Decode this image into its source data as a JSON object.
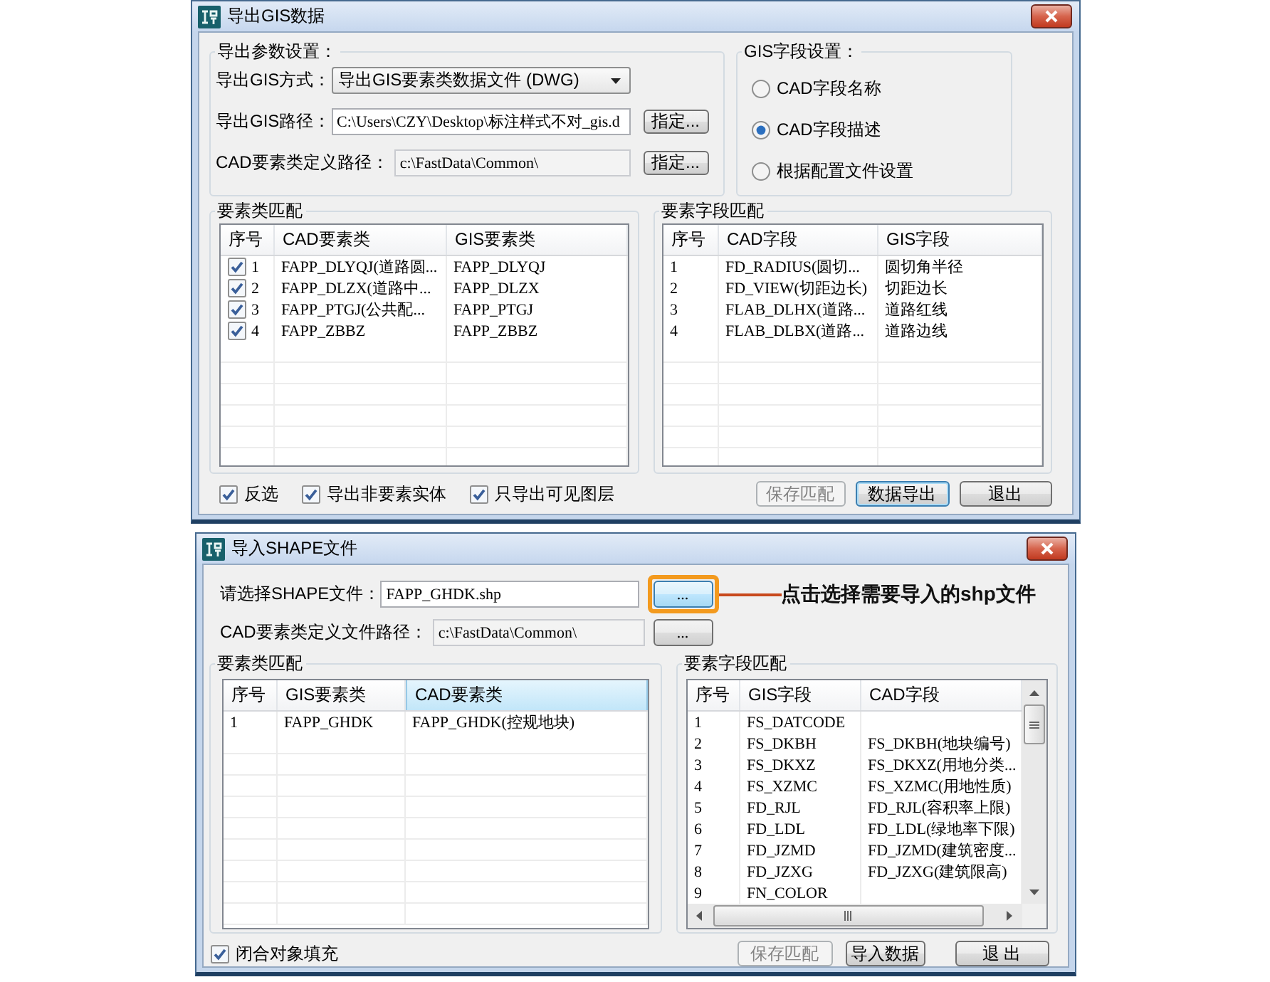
{
  "export_dialog": {
    "title": "导出GIS数据",
    "params": {
      "title": "导出参数设置：",
      "fields": [
        {
          "kind": "dropdown",
          "label": "导出GIS方式：",
          "value": "导出GIS要素类数据文件 (DWG)"
        },
        {
          "kind": "path",
          "label": "导出GIS路径：",
          "value": "C:\\Users\\CZY\\Desktop\\标注样式不对_gis.d",
          "disabled": false,
          "button": "指定..."
        },
        {
          "kind": "path",
          "label": "CAD要素类定义路径：",
          "value": "c:\\FastData\\Common\\",
          "disabled": true,
          "button": "指定..."
        }
      ]
    },
    "field_settings": {
      "title": "GIS字段设置：",
      "options": [
        {
          "label": "CAD字段名称",
          "selected": false
        },
        {
          "label": "CAD字段描述",
          "selected": true
        },
        {
          "label": "根据配置文件设置",
          "selected": false
        }
      ]
    },
    "class_match": {
      "title": "要素类匹配",
      "columns": [
        {
          "label": "序号",
          "selected": false
        },
        {
          "label": "CAD要素类",
          "selected": false
        },
        {
          "label": "GIS要素类",
          "selected": false
        }
      ],
      "rows": [
        {
          "checked": true,
          "cells": [
            "1",
            "FAPP_DLYQJ(道路圆...",
            "FAPP_DLYQJ"
          ]
        },
        {
          "checked": true,
          "cells": [
            "2",
            "FAPP_DLZX(道路中...",
            "FAPP_DLZX"
          ]
        },
        {
          "checked": true,
          "cells": [
            "3",
            "FAPP_PTGJ(公共配...",
            "FAPP_PTGJ"
          ]
        },
        {
          "checked": true,
          "cells": [
            "4",
            "FAPP_ZBBZ",
            "FAPP_ZBBZ"
          ]
        }
      ]
    },
    "field_match": {
      "title": "要素字段匹配",
      "columns": [
        {
          "label": "序号",
          "selected": false
        },
        {
          "label": "CAD字段",
          "selected": false
        },
        {
          "label": "GIS字段",
          "selected": false
        }
      ],
      "rows": [
        {
          "cells": [
            "1",
            "FD_RADIUS(圆切...",
            "圆切角半径"
          ]
        },
        {
          "cells": [
            "2",
            "FD_VIEW(切距边长)",
            "切距边长"
          ]
        },
        {
          "cells": [
            "3",
            "FLAB_DLHX(道路...",
            "道路红线"
          ]
        },
        {
          "cells": [
            "4",
            "FLAB_DLBX(道路...",
            "道路边线"
          ]
        }
      ]
    },
    "options": [
      {
        "label": "反选",
        "checked": true
      },
      {
        "label": "导出非要素实体",
        "checked": true
      },
      {
        "label": "只导出可见图层",
        "checked": true
      }
    ],
    "buttons": [
      {
        "label": "保存匹配",
        "disabled": true,
        "focused": false
      },
      {
        "label": "数据导出",
        "disabled": false,
        "focused": true
      },
      {
        "label": "退出",
        "disabled": false,
        "focused": false
      }
    ]
  },
  "import_dialog": {
    "title": "导入SHAPE文件",
    "file_fields": [
      {
        "label": "请选择SHAPE文件：",
        "value": "FAPP_GHDK.shp",
        "disabled": false,
        "button": {
          "label": "...",
          "focused": true
        },
        "callout": "点击选择需要导入的shp文件"
      },
      {
        "label": "CAD要素类定义文件路径：",
        "value": "c:\\FastData\\Common\\",
        "disabled": true,
        "button": {
          "label": "...",
          "focused": false
        }
      }
    ],
    "class_match": {
      "title": "要素类匹配",
      "columns": [
        {
          "label": "序号",
          "selected": false
        },
        {
          "label": "GIS要素类",
          "selected": false
        },
        {
          "label": "CAD要素类",
          "selected": true
        }
      ],
      "rows": [
        {
          "cells": [
            "1",
            "FAPP_GHDK",
            "FAPP_GHDK(控规地块)"
          ]
        }
      ]
    },
    "field_match": {
      "title": "要素字段匹配",
      "columns": [
        {
          "label": "序号",
          "selected": false
        },
        {
          "label": "GIS字段",
          "selected": false
        },
        {
          "label": "CAD字段",
          "selected": false
        }
      ],
      "rows": [
        {
          "cells": [
            "1",
            "FS_DATCODE"
          ]
        },
        {
          "cells": [
            "2",
            "FS_DKBH",
            "FS_DKBH(地块编号)"
          ]
        },
        {
          "cells": [
            "3",
            "FS_DKXZ",
            "FS_DKXZ(用地分类..."
          ]
        },
        {
          "cells": [
            "4",
            "FS_XZMC",
            "FS_XZMC(用地性质)"
          ]
        },
        {
          "cells": [
            "5",
            "FD_RJL",
            "FD_RJL(容积率上限)"
          ]
        },
        {
          "cells": [
            "6",
            "FD_LDL",
            "FD_LDL(绿地率下限)"
          ]
        },
        {
          "cells": [
            "7",
            "FD_JZMD",
            "FD_JZMD(建筑密度..."
          ]
        },
        {
          "cells": [
            "8",
            "FD_JZXG",
            "FD_JZXG(建筑限高)"
          ]
        },
        {
          "cells": [
            "9",
            "FN_COLOR"
          ]
        }
      ]
    },
    "fill_closed": {
      "label": "闭合对象填充",
      "checked": true
    },
    "buttons": [
      {
        "label": "保存匹配",
        "disabled": true,
        "focused": false
      },
      {
        "label": "导入数据",
        "disabled": false,
        "focused": false
      },
      {
        "label": "退 出",
        "disabled": false,
        "focused": false
      }
    ]
  }
}
